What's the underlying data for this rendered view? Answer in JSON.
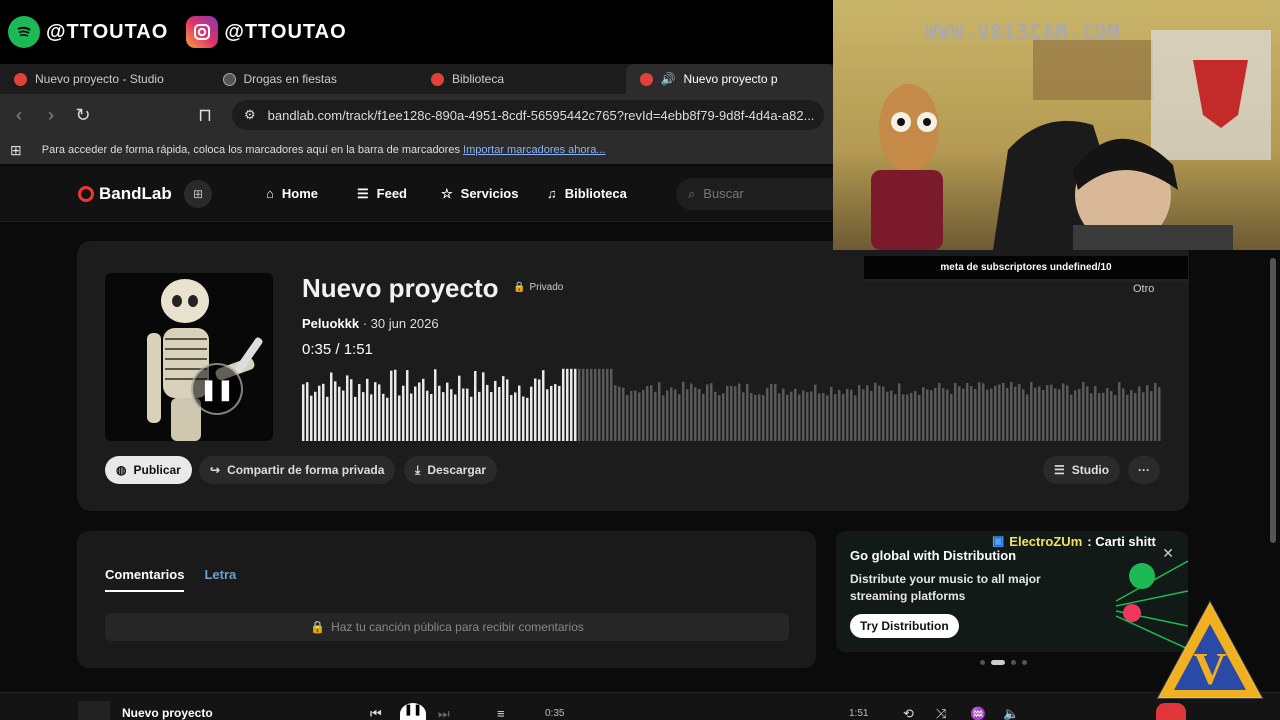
{
  "stream": {
    "spotify_handle": "@TTOUTAO",
    "instagram_handle": "@TTOUTAO",
    "webcam_watermark": "WWW.V813CAM.COM",
    "subscriber_goal": "meta de subscriptores undefined/10",
    "chat_user": "ElectroZUm",
    "chat_text": ": Carti shitt"
  },
  "browser": {
    "tabs": [
      {
        "label": "Nuevo proyecto - Studio"
      },
      {
        "label": "Drogas en fiestas"
      },
      {
        "label": "Biblioteca"
      },
      {
        "label": "Nuevo proyecto p"
      }
    ],
    "url": "bandlab.com/track/f1ee128c-890a-4951-8cdf-56595442c765?revId=4ebb8f79-9d8f-4d4a-a82...",
    "bookmarks_hint": "Para acceder de forma rápida, coloca los marcadores aquí en la barra de marcadores",
    "bookmarks_link": "Importar marcadores ahora..."
  },
  "header": {
    "logo": "BandLab",
    "nav": [
      "Home",
      "Feed",
      "Servicios",
      "Biblioteca"
    ],
    "search_placeholder": "Buscar"
  },
  "track": {
    "title": "Nuevo proyecto",
    "privacy": "Privado",
    "artist": "Peluokkk",
    "date": "· 30 jun 2026",
    "time": "0:35 /  1:51",
    "progress": 0.32,
    "publish": "Publicar",
    "share": "Compartir de forma privada",
    "download": "Descargar",
    "studio": "Studio",
    "more": "···",
    "tag": "Otro"
  },
  "comments": {
    "tabs": [
      "Comentarios",
      "Letra"
    ],
    "notice": "Haz tu canción pública para recibir comentarios"
  },
  "promo": {
    "title": "Go global with Distribution",
    "text": "Distribute your music to all major streaming platforms",
    "cta": "Try Distribution"
  },
  "player": {
    "title": "Nuevo proyecto",
    "current": "0:35",
    "total": "1:51"
  }
}
